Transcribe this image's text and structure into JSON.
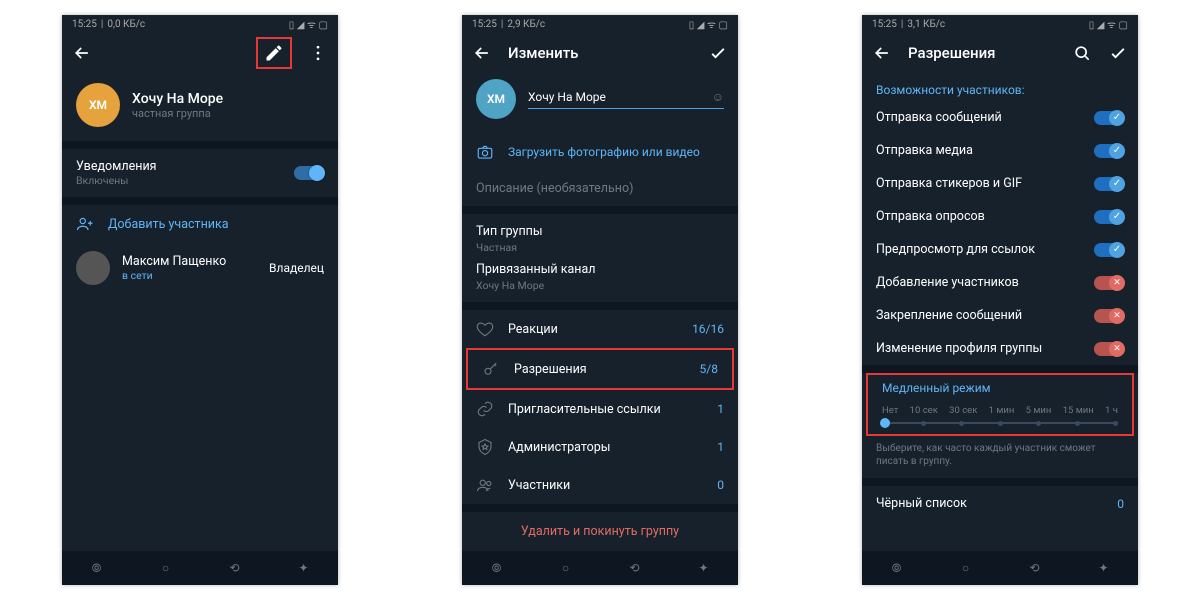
{
  "status": {
    "time": "15:25",
    "speed1": "0,0 КБ/с",
    "speed2": "2,9 КБ/с",
    "speed3": "3,1 КБ/с"
  },
  "screen1": {
    "avatar_text": "ХМ",
    "group_name": "Хочу На Море",
    "group_sub": "частная группа",
    "notifications_label": "Уведомления",
    "notifications_sub": "Включены",
    "add_member": "Добавить участника",
    "member_name": "Максим Пащенко",
    "member_status": "в сети",
    "member_role": "Владелец"
  },
  "screen2": {
    "title": "Изменить",
    "avatar_text": "ХМ",
    "name_value": "Хочу На Море",
    "upload_label": "Загрузить фотографию или видео",
    "description_placeholder": "Описание (необязательно)",
    "group_type_label": "Тип группы",
    "group_type_value": "Частная",
    "linked_channel_label": "Привязанный канал",
    "linked_channel_value": "Хочу На Море",
    "reactions_label": "Реакции",
    "reactions_value": "16/16",
    "permissions_label": "Разрешения",
    "permissions_value": "5/8",
    "invite_links_label": "Пригласительные ссылки",
    "invite_links_value": "1",
    "admins_label": "Администраторы",
    "admins_value": "1",
    "members_label": "Участники",
    "members_value": "0",
    "delete_label": "Удалить и покинуть группу"
  },
  "screen3": {
    "title": "Разрешения",
    "section_title": "Возможности участников:",
    "perms": [
      {
        "label": "Отправка сообщений",
        "on": true
      },
      {
        "label": "Отправка медиа",
        "on": true
      },
      {
        "label": "Отправка стикеров и GIF",
        "on": true
      },
      {
        "label": "Отправка опросов",
        "on": true
      },
      {
        "label": "Предпросмотр для ссылок",
        "on": true
      },
      {
        "label": "Добавление участников",
        "on": false
      },
      {
        "label": "Закрепление сообщений",
        "on": false
      },
      {
        "label": "Изменение профиля группы",
        "on": false
      }
    ],
    "slow_mode_title": "Медленный режим",
    "slow_options": [
      "Нет",
      "10 сек",
      "30 сек",
      "1 мин",
      "5 мин",
      "15 мин",
      "1 ч"
    ],
    "slow_hint": "Выберите, как часто каждый участник сможет писать в группу.",
    "blacklist_label": "Чёрный список",
    "blacklist_value": "0"
  }
}
